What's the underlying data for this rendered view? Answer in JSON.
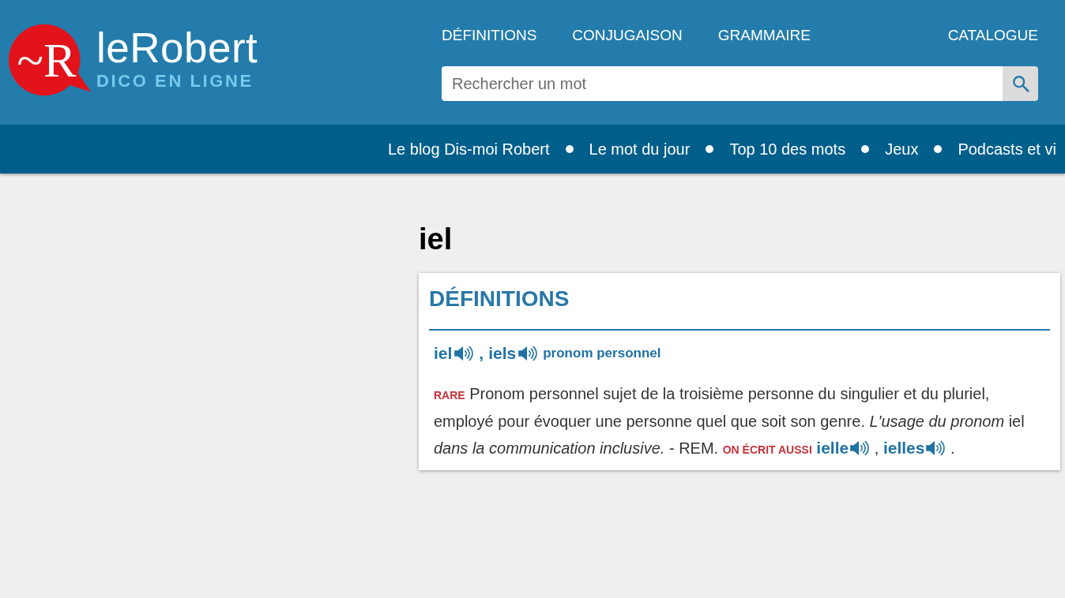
{
  "header": {
    "logo": {
      "mark": "~R",
      "name": "leRobert",
      "tagline": "DICO EN LIGNE"
    },
    "nav": [
      {
        "label": "DÉFINITIONS"
      },
      {
        "label": "CONJUGAISON"
      },
      {
        "label": "GRAMMAIRE"
      }
    ],
    "nav_right": [
      {
        "label": "CATALOGUE"
      }
    ],
    "search": {
      "placeholder": "Rechercher un mot"
    }
  },
  "subnav": {
    "items": [
      {
        "label": "Le blog Dis-moi Robert"
      },
      {
        "label": "Le mot du jour"
      },
      {
        "label": "Top 10 des mots"
      },
      {
        "label": "Jeux"
      },
      {
        "label": "Podcasts et vi"
      }
    ]
  },
  "page_title": "iel",
  "definitions": {
    "heading": "DÉFINITIONS",
    "entry": {
      "forms": [
        {
          "word": "iel"
        },
        {
          "word": "iels"
        }
      ],
      "separator": ",",
      "category": "pronom personnel"
    },
    "definition": {
      "label": "RARE",
      "text": "Pronom personnel sujet de la troisième personne du singulier et du pluriel, employé pour évoquer une personne quel que soit son genre.",
      "example": "*L'usage du pronom* iel *dans la communication inclusive.*",
      "remark": "- REM.",
      "remark_label": "ON ÉCRIT AUSSI",
      "variants": [
        {
          "word": "ielle"
        },
        {
          "word": "ielles"
        }
      ],
      "separator": ",",
      "closing": "."
    }
  }
}
